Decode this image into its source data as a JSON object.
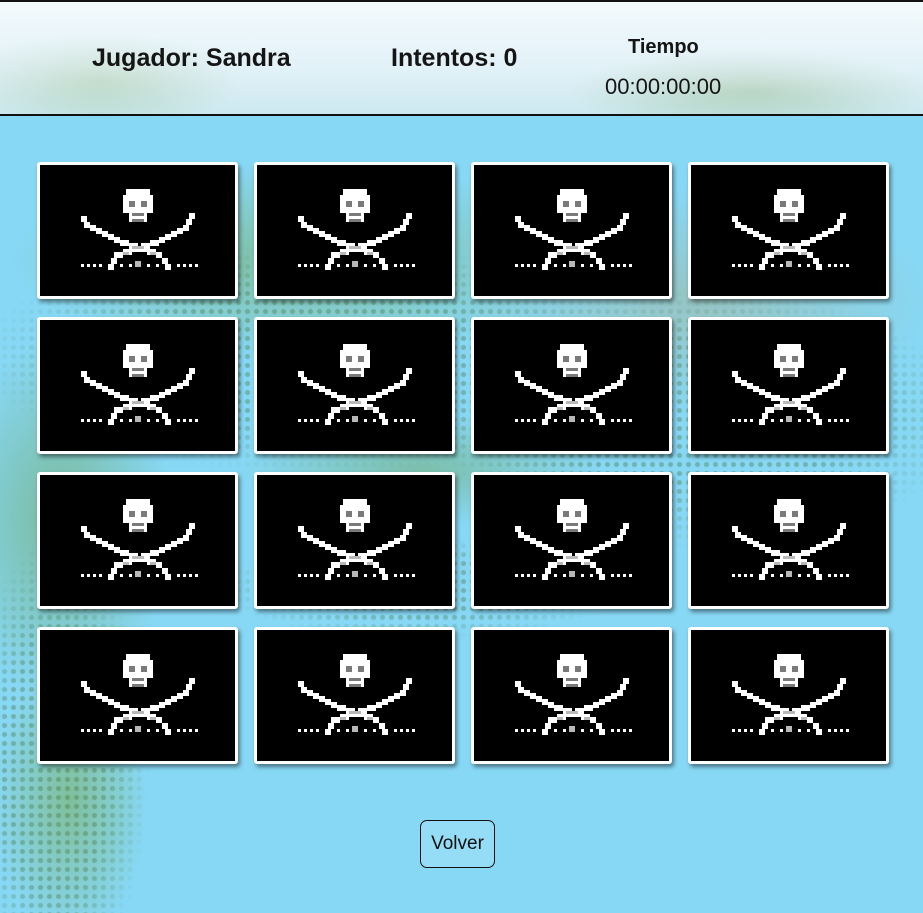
{
  "header": {
    "player_label": "Jugador: Sandra",
    "attempts_label": "Intentos: 0",
    "timer_label": "Tiempo",
    "timer_value": "00:00:00:00"
  },
  "board": {
    "rows": 4,
    "columns": 4,
    "card_back_icon": "pirate-flag-icon",
    "cards": [
      {
        "state": "face-down"
      },
      {
        "state": "face-down"
      },
      {
        "state": "face-down"
      },
      {
        "state": "face-down"
      },
      {
        "state": "face-down"
      },
      {
        "state": "face-down"
      },
      {
        "state": "face-down"
      },
      {
        "state": "face-down"
      },
      {
        "state": "face-down"
      },
      {
        "state": "face-down"
      },
      {
        "state": "face-down"
      },
      {
        "state": "face-down"
      },
      {
        "state": "face-down"
      },
      {
        "state": "face-down"
      },
      {
        "state": "face-down"
      },
      {
        "state": "face-down"
      }
    ]
  },
  "footer": {
    "back_label": "Volver"
  },
  "colors": {
    "background": "#87d8f5",
    "card_back": "#000000",
    "card_border": "#ffffff"
  }
}
